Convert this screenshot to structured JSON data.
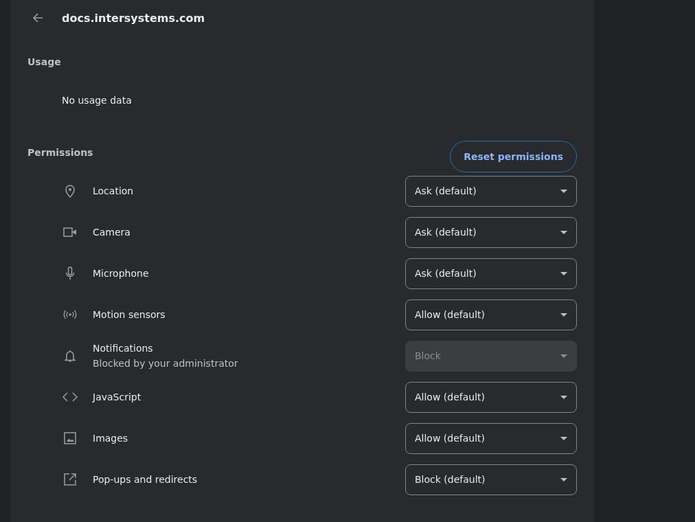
{
  "header": {
    "title": "docs.intersystems.com"
  },
  "usage": {
    "heading": "Usage",
    "text": "No usage data"
  },
  "permissions": {
    "heading": "Permissions",
    "reset_button": "Reset permissions",
    "items": [
      {
        "kind": "location",
        "label": "Location",
        "value": "Ask (default)",
        "disabled": false
      },
      {
        "kind": "camera",
        "label": "Camera",
        "value": "Ask (default)",
        "disabled": false
      },
      {
        "kind": "microphone",
        "label": "Microphone",
        "value": "Ask (default)",
        "disabled": false
      },
      {
        "kind": "sensors",
        "label": "Motion sensors",
        "value": "Allow (default)",
        "disabled": false
      },
      {
        "kind": "notifications",
        "label": "Notifications",
        "sublabel": "Blocked by your administrator",
        "value": "Block",
        "disabled": true
      },
      {
        "kind": "code",
        "label": "JavaScript",
        "value": "Allow (default)",
        "disabled": false
      },
      {
        "kind": "image",
        "label": "Images",
        "value": "Allow (default)",
        "disabled": false
      },
      {
        "kind": "popup",
        "label": "Pop-ups and redirects",
        "value": "Block (default)",
        "disabled": false
      }
    ]
  }
}
